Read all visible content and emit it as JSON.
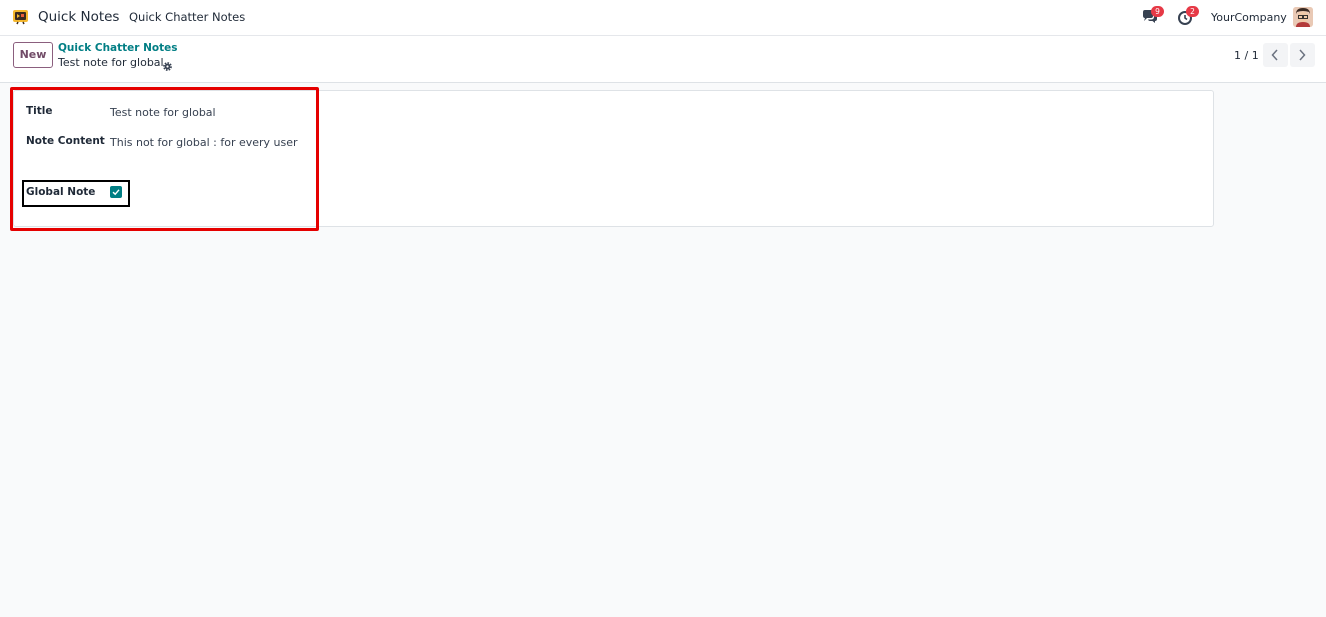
{
  "navbar": {
    "app_name": "Quick Notes",
    "menu_item": "Quick Chatter Notes",
    "messages_count": "9",
    "activities_count": "2",
    "company": "YourCompany",
    "icons": [
      "app-logo-icon",
      "chat-bubbles-icon",
      "clock-icon",
      "user-avatar"
    ]
  },
  "control_panel": {
    "new_label": "New",
    "breadcrumb_parent": "Quick Chatter Notes",
    "breadcrumb_current": "Test note for global",
    "pager_value": "1 / 1",
    "icons": [
      "gear-icon",
      "chevron-left-icon",
      "chevron-right-icon"
    ]
  },
  "form": {
    "title_label": "Title",
    "title_value": "Test note for global",
    "content_label": "Note Content",
    "content_value": "This not for global : for every user",
    "global_label": "Global Note",
    "global_checked": true
  },
  "colors": {
    "accent_teal": "#017e84",
    "brand_purple": "#714b67",
    "badge_red": "#e63946",
    "annotation_red": "#e50000",
    "annotation_black": "#000000"
  }
}
